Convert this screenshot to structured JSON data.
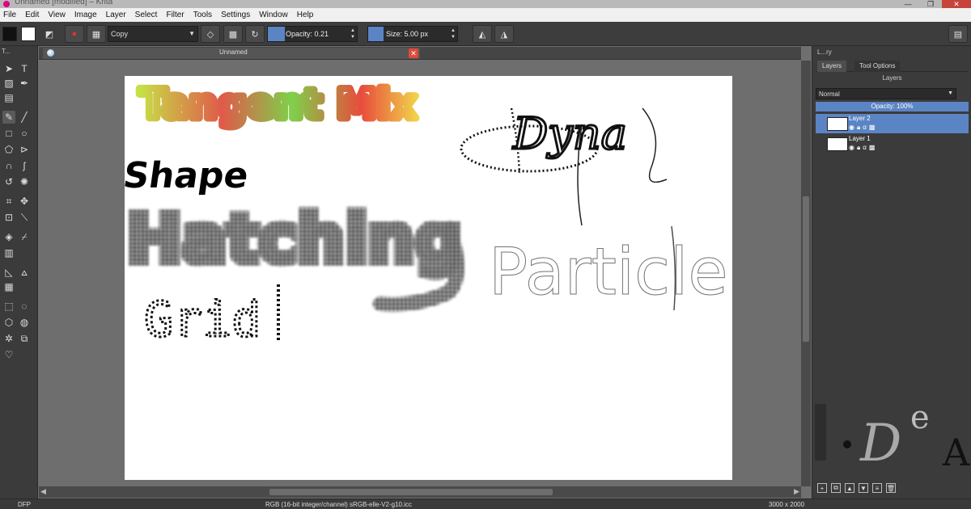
{
  "window": {
    "title": "Unnamed [modified] – Krita"
  },
  "menu": [
    "File",
    "Edit",
    "View",
    "Image",
    "Layer",
    "Select",
    "Filter",
    "Tools",
    "Settings",
    "Window",
    "Help"
  ],
  "toolbar": {
    "blend_mode": "Copy",
    "opacity_label": "Opacity:  0.21",
    "opacity_value": 0.21,
    "size_label": "Size:  5.00 px",
    "size_value": 5.0
  },
  "toolbox": {
    "header": "T..."
  },
  "document_tab": {
    "title": "Unnamed"
  },
  "docker": {
    "header": "L...ry",
    "tabs": [
      "Layers",
      "Tool Options"
    ],
    "title": "Layers",
    "blend_mode": "Normal",
    "opacity": "Opacity:  100%",
    "layers": [
      {
        "name": "Layer 2",
        "selected": true
      },
      {
        "name": "Layer 1",
        "selected": false
      }
    ]
  },
  "canvas_text": {
    "tangent": "Tangent Mix",
    "shape": "Shape",
    "hatching": "Hatching",
    "grid": "Grid",
    "dyna": "Dyna",
    "particle": "Particle"
  },
  "status": {
    "left": "DFP",
    "profile": "RGB (16-bit integer/channel)  sRGB-elle-V2-g10.icc",
    "size": "3000 x 2000"
  },
  "colors": {
    "accent": "#5b84c4",
    "panel": "#3b3b3b",
    "canvas_bg": "#6e6e6e"
  }
}
